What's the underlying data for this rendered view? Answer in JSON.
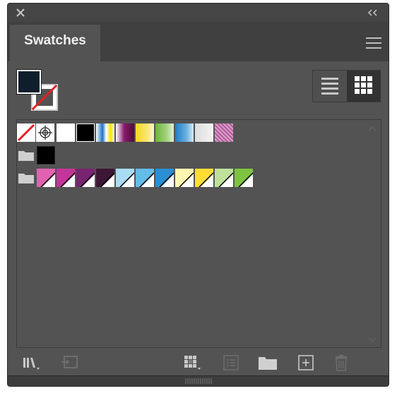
{
  "panel": {
    "tab_title": "Swatches"
  },
  "swatches": {
    "row1": [
      "none",
      "registration",
      "#ffffff",
      "#000000",
      "gradient-blue-yellow",
      "gradient-magenta",
      "gradient-yellow",
      "gradient-green",
      "gradient-blue",
      "gradient-transparent",
      "pattern-pink"
    ],
    "row2_group": [
      "#000000"
    ],
    "row3_group": [
      "#e062b1",
      "#c2359a",
      "#7a2370",
      "#3d1735",
      "#a9dcf4",
      "#63bde8",
      "#2a8fd2",
      "#fff7b0",
      "#fddd35",
      "#c0e19c",
      "#7ec442"
    ]
  },
  "colors": {
    "panel_bg": "#535353",
    "tabbar_bg": "#404040",
    "fill": "#0f1e2c",
    "none_slash": "#e41e26"
  }
}
